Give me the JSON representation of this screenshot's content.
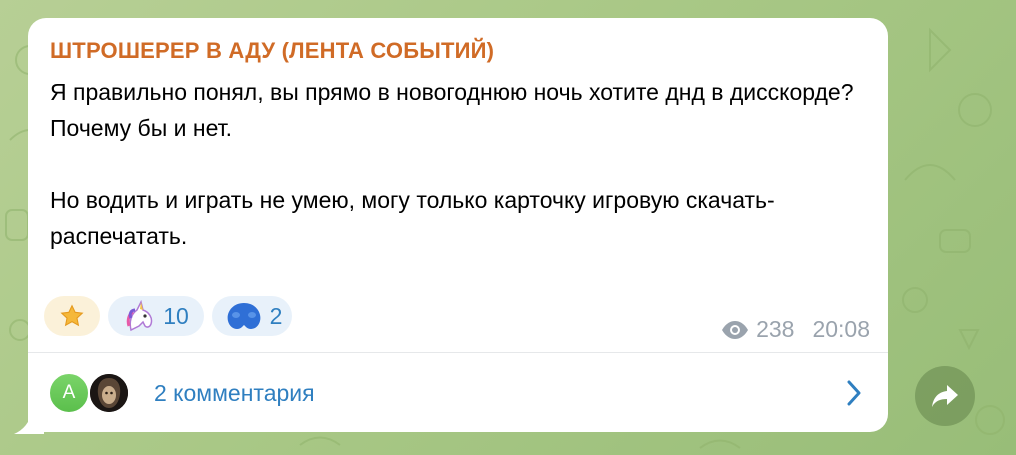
{
  "post": {
    "channel_name": "ШТРОШЕРЕР В АДУ (ЛЕНТА СОБЫТИЙ)",
    "text_line_1": "Я правильно понял, вы прямо в новогоднюю ночь хотите днд в дисскорде?",
    "text_line_2": "Почему бы и нет.",
    "text_line_3": "Но водить и играть не умею, могу только карточку игровую скачать-распечатать.",
    "views": "238",
    "time": "20:08"
  },
  "reactions": [
    {
      "icon": "star-icon",
      "count": ""
    },
    {
      "icon": "unicorn-icon",
      "count": "10"
    },
    {
      "icon": "blue-balls-icon",
      "count": "2"
    }
  ],
  "comments": {
    "avatar_initial": "A",
    "label": "2 комментария"
  },
  "colors": {
    "channel_name": "#d06b26",
    "link_blue": "#2f7fc0",
    "meta_gray": "#9aa3ad",
    "background": "#a9c886"
  }
}
